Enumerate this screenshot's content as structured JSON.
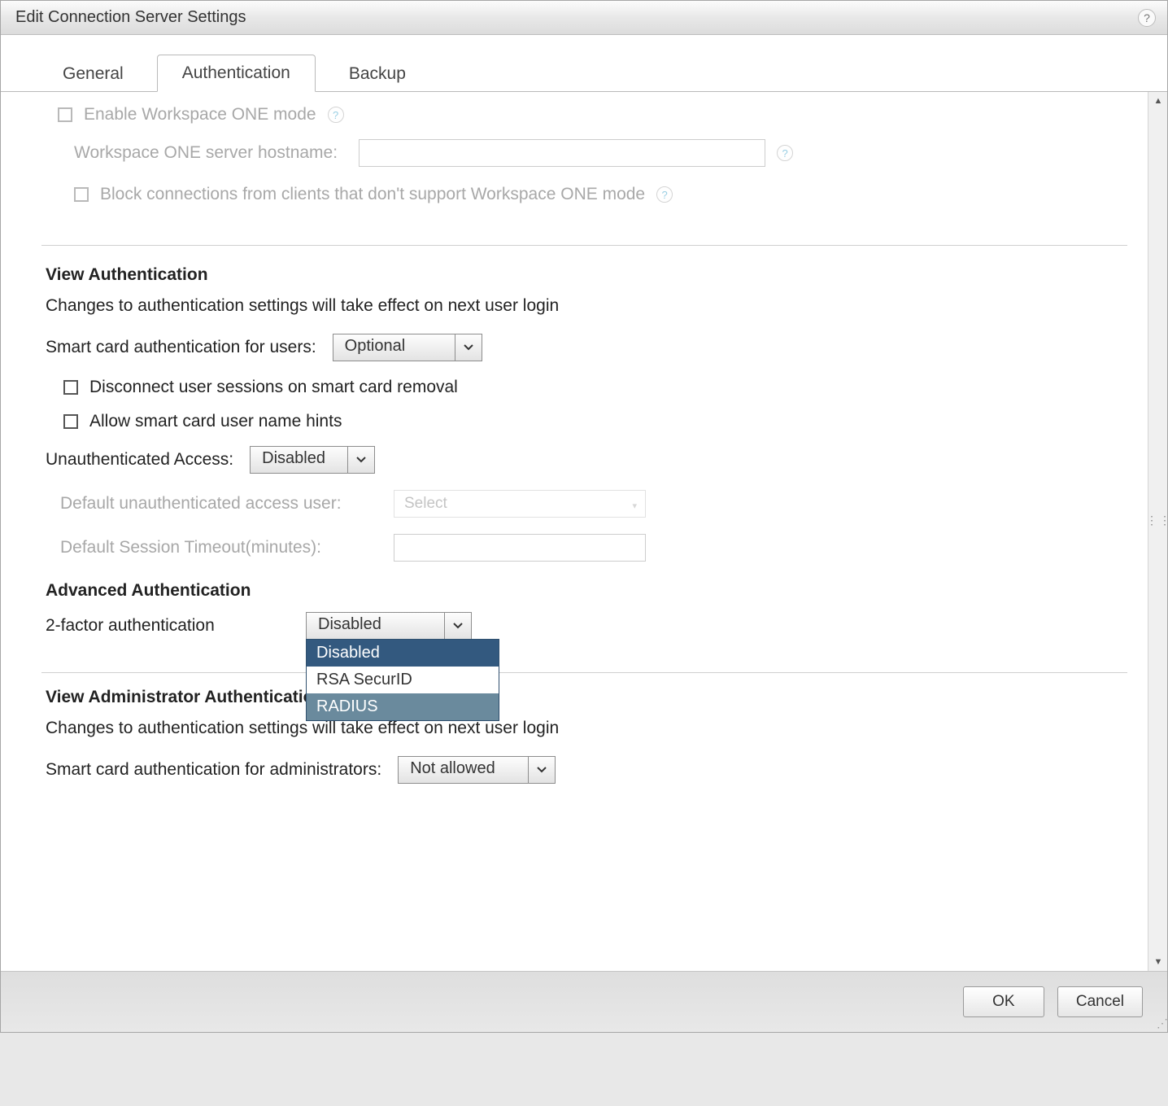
{
  "dialog": {
    "title": "Edit Connection Server Settings"
  },
  "tabs": {
    "general": "General",
    "authentication": "Authentication",
    "backup": "Backup",
    "active": "authentication"
  },
  "workspace_one": {
    "enable_label": "Enable Workspace ONE mode",
    "hostname_label": "Workspace ONE server hostname:",
    "hostname_value": "",
    "block_label": "Block connections from clients that don't support Workspace ONE mode"
  },
  "view_auth": {
    "heading": "View Authentication",
    "note": "Changes to authentication settings will take effect on next user login",
    "smartcard_label": "Smart card authentication for users:",
    "smartcard_value": "Optional",
    "disconnect_label": "Disconnect user sessions on smart card removal",
    "hints_label": "Allow smart card user name hints",
    "unauth_label": "Unauthenticated Access:",
    "unauth_value": "Disabled",
    "default_user_label": "Default unauthenticated access user:",
    "default_user_placeholder": "Select",
    "timeout_label": "Default Session Timeout(minutes):",
    "timeout_value": ""
  },
  "adv_auth": {
    "heading": "Advanced Authentication",
    "twofa_label": "2-factor authentication",
    "twofa_value": "Disabled",
    "twofa_options": [
      "Disabled",
      "RSA SecurID",
      "RADIUS"
    ],
    "twofa_selected_index": 0,
    "twofa_hover_index": 2
  },
  "admin_auth": {
    "heading": "View Administrator Authentication",
    "note": "Changes to authentication settings will take effect on next user login",
    "smartcard_label": "Smart card authentication for administrators:",
    "smartcard_value": "Not allowed"
  },
  "buttons": {
    "ok": "OK",
    "cancel": "Cancel"
  }
}
